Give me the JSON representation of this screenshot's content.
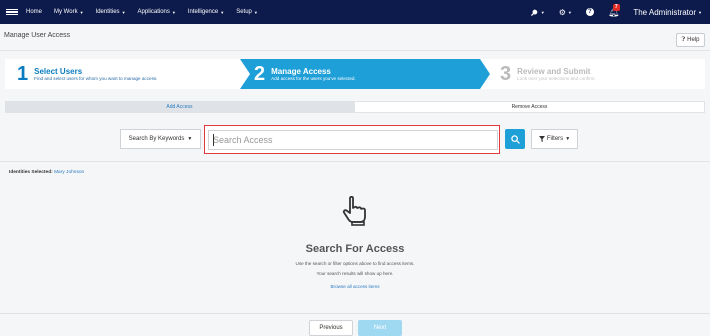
{
  "nav": {
    "items": [
      "Home",
      "My Work",
      "Identities",
      "Applications",
      "Intelligence",
      "Setup"
    ],
    "wrench_icon": "wrench-icon",
    "gear_icon": "gear-icon",
    "help_label": "?",
    "notifications_count": "7",
    "user_name": "The Administrator"
  },
  "header": {
    "title": "Manage User Access",
    "help_label": "Help"
  },
  "steps": [
    {
      "num": "1",
      "title": "Select Users",
      "subtitle": "Find and select users for whom you want to manage access."
    },
    {
      "num": "2",
      "title": "Manage Access",
      "subtitle": "Add access for the users you've selected."
    },
    {
      "num": "3",
      "title": "Review and Submit",
      "subtitle": "Look over your selections and confirm."
    }
  ],
  "tabs": {
    "add": "Add Access",
    "remove": "Remove Access"
  },
  "search": {
    "mode_label": "Search By Keywords",
    "placeholder": "Search Access",
    "filters_label": "Filters"
  },
  "identities": {
    "label": "Identities Selected:",
    "name": "Mary Johnson"
  },
  "empty_state": {
    "title": "Search For Access",
    "desc": "Use the search or filter options above to find access items.",
    "desc2": "Your search results will show up here.",
    "browse_link": "Browse all access items"
  },
  "footer": {
    "previous": "Previous",
    "next": "Next"
  },
  "colors": {
    "nav_bg": "#0d1b4c",
    "accent": "#1e9fd8",
    "highlight_border": "#e03a3a",
    "badge": "#e02b27"
  }
}
